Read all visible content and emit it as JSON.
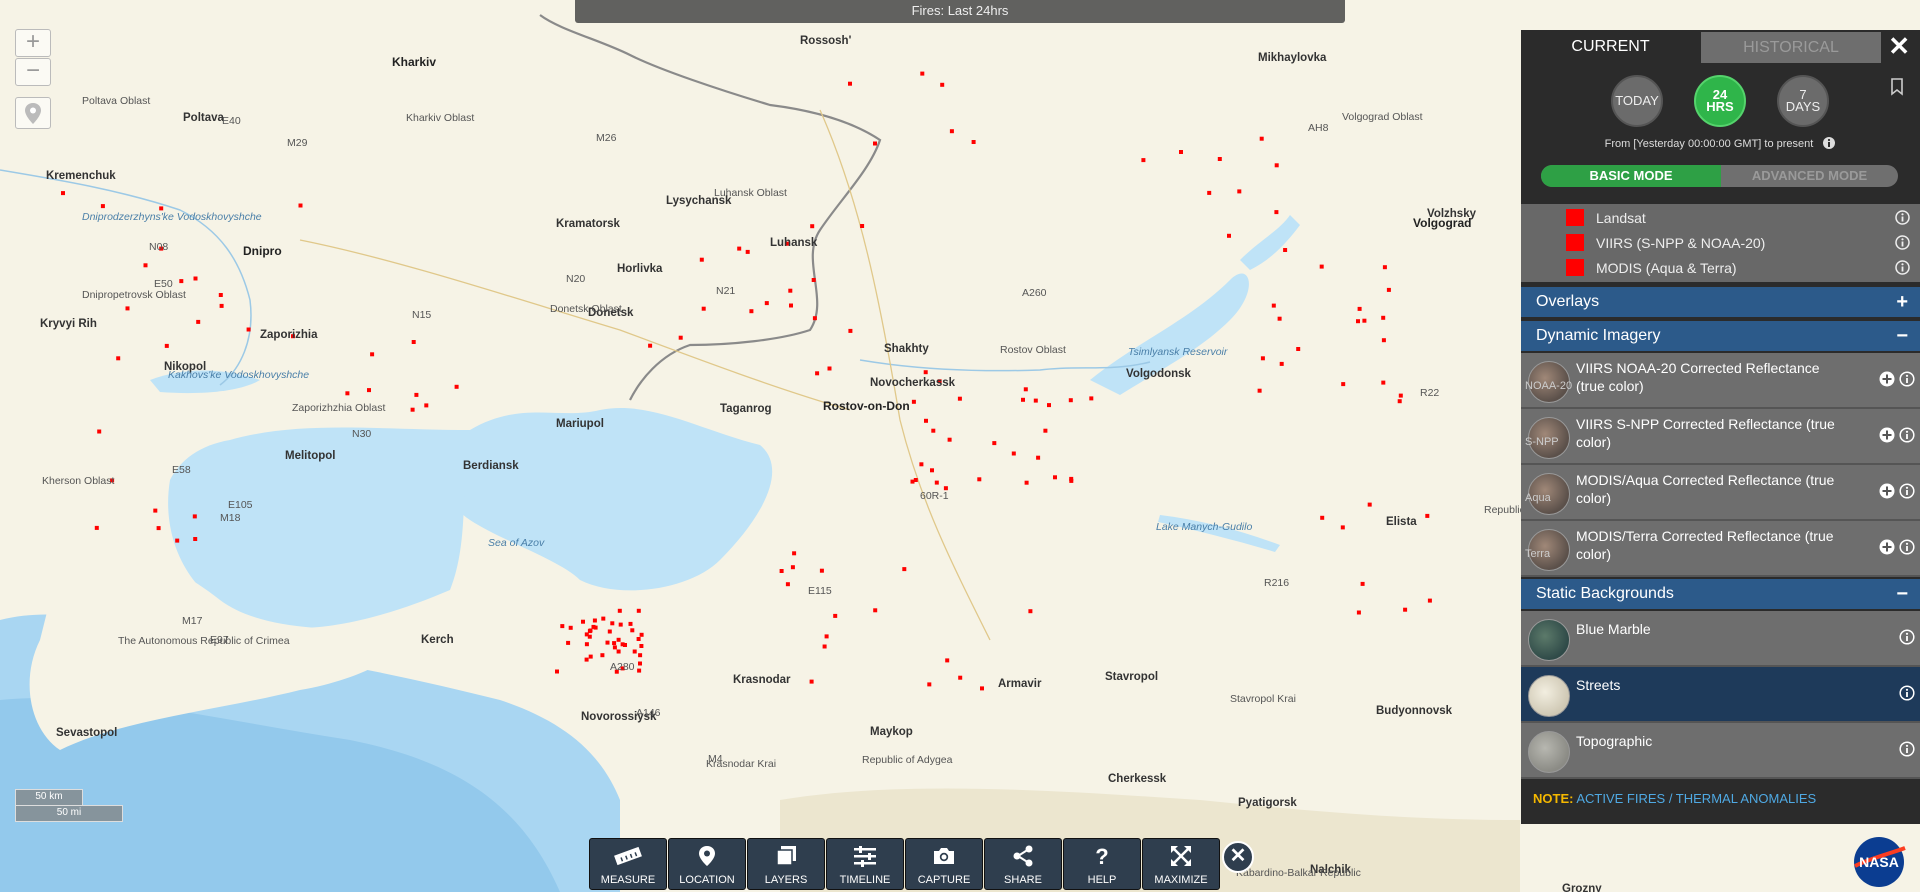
{
  "title_bar": "Fires: Last 24hrs",
  "zoom": {
    "in": "+",
    "out": "−"
  },
  "scale": {
    "km": "50 km",
    "mi": "50 mi"
  },
  "map_labels": {
    "cities": [
      "Kharkiv",
      "Poltava",
      "Dnipro",
      "Zaporizhia",
      "Donetsk",
      "Luhansk",
      "Mariupol",
      "Taganrog",
      "Rostov-on-Don",
      "Volgograd",
      "Volgodonsk",
      "Krasnodar",
      "Stavropol",
      "Kerch",
      "Novorossiysk",
      "Maykop",
      "Armavir",
      "Cherkessk",
      "Pyatigorsk",
      "Elista",
      "Nalchik",
      "Grozny",
      "Nikopol",
      "Melitopol",
      "Berdiansk",
      "Kramatorsk",
      "Lysychansk",
      "Horlivka",
      "Shakhty",
      "Novocherkassk",
      "Sevastopol",
      "Budyonnovsk",
      "Kryvyi Rih",
      "Kremenchuk",
      "Rossosh'",
      "Mikhaylovka",
      "Volzhsky"
    ],
    "regions": [
      "Kharkiv Oblast",
      "Poltava Oblast",
      "Luhansk Oblast",
      "Donetsk Oblast",
      "Dnipropetrovsk Oblast",
      "Zaporizhzhia Oblast",
      "Kherson Oblast",
      "Rostov Oblast",
      "Volgograd Oblast",
      "Krasnodar Krai",
      "Stavropol Krai",
      "Republic of Adygea",
      "The Autonomous Republic of Crimea",
      "Republic of Kalmykia",
      "Kabardino-Balkar Republic"
    ],
    "water": [
      "Sea of Azov",
      "Tsimlyansk Reservoir",
      "Kakhovs'ke Vodoskhovyshche",
      "Lake Manych-Gudilo",
      "Dniprodzerzhyns'ke Vodoskhovyshche"
    ],
    "roads": [
      "M29",
      "E40",
      "M26",
      "N08",
      "E50",
      "N15",
      "N20",
      "N21",
      "N30",
      "E58",
      "E105",
      "M18",
      "M17",
      "E97",
      "A260",
      "AH8",
      "R22",
      "A280",
      "A146",
      "E115",
      "R216",
      "60R-1",
      "M4"
    ]
  },
  "sidebar": {
    "tabs": {
      "current": "CURRENT",
      "historical": "HISTORICAL"
    },
    "ranges": {
      "today": "TODAY",
      "hrs24_a": "24",
      "hrs24_b": "HRS",
      "days7_a": "7",
      "days7_b": "DAYS"
    },
    "range_text": "From [Yesterday 00:00:00 GMT] to present",
    "modes": {
      "basic": "BASIC MODE",
      "advanced": "ADVANCED MODE"
    },
    "fire_layers": [
      "Landsat",
      "VIIRS (S-NPP & NOAA-20)",
      "MODIS (Aqua & Terra)"
    ],
    "sections": {
      "overlays": "Overlays",
      "dynamic": "Dynamic Imagery",
      "static": "Static Backgrounds"
    },
    "dynamic_layers": [
      {
        "name": "VIIRS NOAA-20 Corrected Reflectance (true color)",
        "tag": "NOAA-20"
      },
      {
        "name": "VIIRS S-NPP Corrected Reflectance (true color)",
        "tag": "S-NPP"
      },
      {
        "name": "MODIS/Aqua Corrected Reflectance (true color)",
        "tag": "Aqua"
      },
      {
        "name": "MODIS/Terra Corrected Reflectance (true color)",
        "tag": "Terra"
      }
    ],
    "static_layers": [
      "Blue Marble",
      "Streets",
      "Topographic"
    ],
    "note_label": "NOTE:",
    "note_text": "ACTIVE FIRES / THERMAL ANOMALIES"
  },
  "toolbar": {
    "measure": "MEASURE",
    "location": "LOCATION",
    "layers": "LAYERS",
    "timeline": "TIMELINE",
    "capture": "CAPTURE",
    "share": "SHARE",
    "help": "HELP",
    "maximize": "MAXIMIZE"
  },
  "colors": {
    "fire": "#ff0000",
    "sea": "#bfe3f7",
    "land": "#f6f3e6",
    "sidebar": "#2b2b2b",
    "section_header": "#2c5a8a",
    "active_green": "#2fb54a",
    "note_label": "#f5b800",
    "note_link": "#4fa9e3"
  }
}
